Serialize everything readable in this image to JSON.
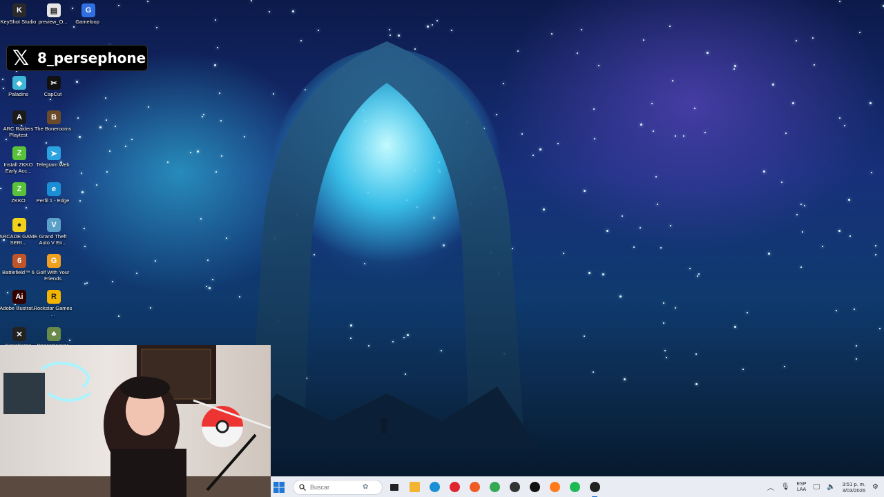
{
  "social": {
    "handle": "8_persephone"
  },
  "desktop_icons": [
    {
      "label": "KeyShot Studio",
      "icon": "keyshot-icon",
      "color": "#2a2a2a",
      "glyph": "K"
    },
    {
      "label": "preview_O...",
      "icon": "document-icon",
      "color": "#e7e7e7",
      "glyph": "▤"
    },
    {
      "label": "Gameloop",
      "icon": "gameloop-icon",
      "color": "#2f6fe0",
      "glyph": "G"
    },
    {
      "label": "Paladins",
      "icon": "paladins-icon",
      "color": "#3fb5d8",
      "glyph": "◆"
    },
    {
      "label": "CapCut",
      "icon": "capcut-icon",
      "color": "#111111",
      "glyph": "✂"
    },
    {
      "label": "ARC Raiders Playtest",
      "icon": "arc-raiders-icon",
      "color": "#1b1b1b",
      "glyph": "A"
    },
    {
      "label": "The Bonerooms",
      "icon": "bonerooms-icon",
      "color": "#6b4a2a",
      "glyph": "B"
    },
    {
      "label": "Install ZKKO Early Acc...",
      "icon": "zkko-installer-icon",
      "color": "#59c23a",
      "glyph": "Z"
    },
    {
      "label": "Telegram Web",
      "icon": "telegram-icon",
      "color": "#2aa3e0",
      "glyph": "➤"
    },
    {
      "label": "ZKKO",
      "icon": "zkko-icon",
      "color": "#59c23a",
      "glyph": "Z"
    },
    {
      "label": "Perfil 1 - Edge",
      "icon": "edge-icon",
      "color": "#1a8fd6",
      "glyph": "e"
    },
    {
      "label": "ARCADE GAME SERI...",
      "icon": "arcade-icon",
      "color": "#f2d21a",
      "glyph": "●"
    },
    {
      "label": "Grand Theft Auto V En...",
      "icon": "gta-icon",
      "color": "#5aa0c8",
      "glyph": "V"
    },
    {
      "label": "Battlefield™ 6",
      "icon": "battlefield-icon",
      "color": "#c0552a",
      "glyph": "6"
    },
    {
      "label": "Golf With Your Friends",
      "icon": "golf-icon",
      "color": "#f0a020",
      "glyph": "G"
    },
    {
      "label": "Adobe Illustrat...",
      "icon": "illustrator-icon",
      "color": "#330000",
      "glyph": "Ai"
    },
    {
      "label": "Rockstar Games ...",
      "icon": "rockstar-icon",
      "color": "#f5b400",
      "glyph": "R"
    },
    {
      "label": "GeneForge",
      "icon": "generic-app-icon",
      "color": "#222222",
      "glyph": "✕"
    },
    {
      "label": "PeaceKeeper",
      "icon": "generic-game-icon",
      "color": "#6a8a4a",
      "glyph": "♣"
    }
  ],
  "taskbar": {
    "search_placeholder": "Buscar",
    "apps": [
      {
        "name": "file-explorer",
        "icon": "folder-icon"
      },
      {
        "name": "edge",
        "icon": "edge-icon"
      },
      {
        "name": "opera",
        "icon": "opera-icon"
      },
      {
        "name": "brave",
        "icon": "brave-icon"
      },
      {
        "name": "chrome",
        "icon": "chrome-icon"
      },
      {
        "name": "obs",
        "icon": "obs-icon"
      },
      {
        "name": "arc-raiders",
        "icon": "arc-raiders-icon"
      },
      {
        "name": "firefox",
        "icon": "firefox-icon"
      },
      {
        "name": "spotify",
        "icon": "spotify-icon"
      },
      {
        "name": "obs-studio",
        "icon": "obs-studio-icon"
      }
    ],
    "language": {
      "line1": "ESP",
      "line2": "LAA"
    },
    "clock": {
      "time": "3:51 p. m.",
      "date": "3/03/2026"
    }
  }
}
